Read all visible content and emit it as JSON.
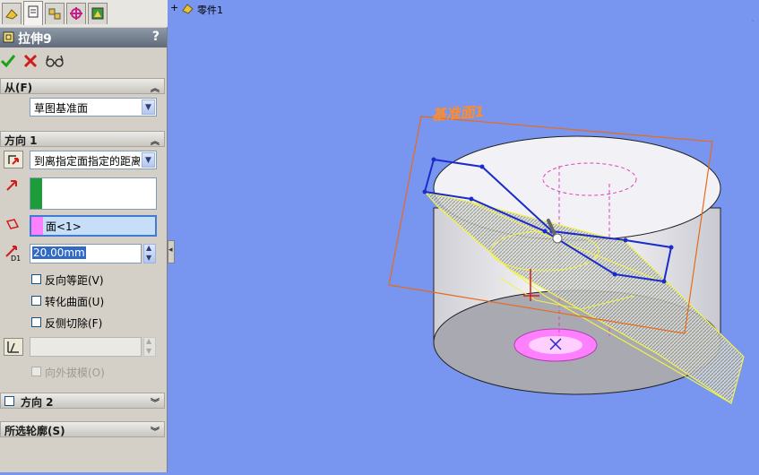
{
  "feature": {
    "title": "拉伸9",
    "help": "?"
  },
  "from": {
    "header": "从(F)",
    "option": "草图基准面"
  },
  "direction1": {
    "header": "方向 1",
    "end_condition": "到离指定面指定的距离",
    "face_ref": "面<1>",
    "distance": "20.00mm",
    "distance_icon_label": "D1",
    "reverse_offset": "反向等距(V)",
    "translate_surface": "转化曲面(U)",
    "flip_cut": "反侧切除(F)",
    "draft_outward": "向外拔模(O)"
  },
  "direction2": {
    "header": "方向 2"
  },
  "selected_contours": {
    "header": "所选轮廓(S)"
  },
  "tree": {
    "expander": "+",
    "part_name": "零件1"
  },
  "viewport": {
    "plane_label": "基准面1"
  },
  "colors": {
    "viewport_bg": "#7896f0",
    "plane_label": "#ff8c28",
    "sketch": "#1a2ccc",
    "preview": "#ffff66",
    "face_highlight": "#ff80ff"
  }
}
